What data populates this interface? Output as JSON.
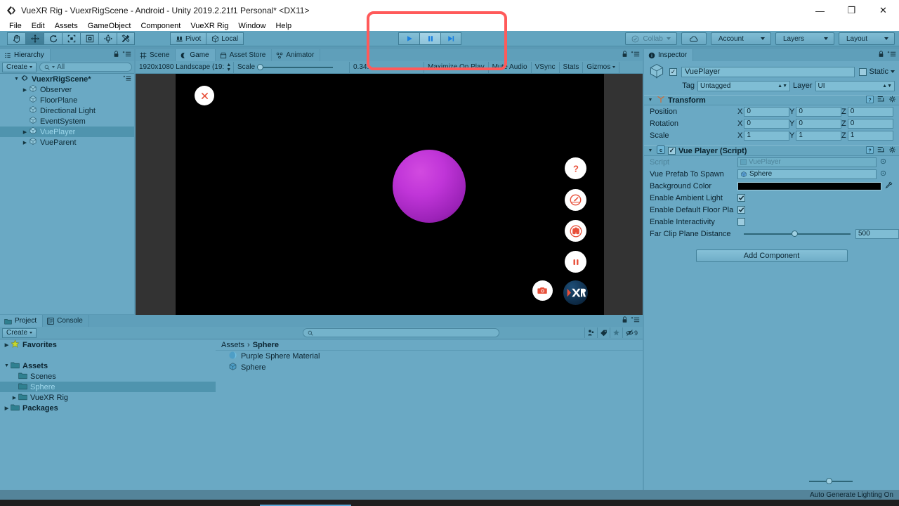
{
  "window": {
    "title": "VueXR Rig - VuexrRigScene - Android - Unity 2019.2.21f1 Personal* <DX11>",
    "app_icon": "unity-logo-icon",
    "minimize": "—",
    "restore": "❐",
    "close": "✕"
  },
  "menubar": {
    "items": [
      "File",
      "Edit",
      "Assets",
      "GameObject",
      "Component",
      "VueXR Rig",
      "Window",
      "Help"
    ]
  },
  "toolbar": {
    "tools": [
      {
        "name": "hand-tool",
        "icon": "hand-icon",
        "active": false
      },
      {
        "name": "move-tool",
        "icon": "move-arrows-icon",
        "active": true
      },
      {
        "name": "rotate-tool",
        "icon": "rotate-icon",
        "active": false
      },
      {
        "name": "scale-tool",
        "icon": "scale-icon",
        "active": false
      },
      {
        "name": "rect-tool",
        "icon": "rect-transform-icon",
        "active": false
      },
      {
        "name": "transform-tool",
        "icon": "combined-transform-icon",
        "active": false
      },
      {
        "name": "custom-editor-tool",
        "icon": "tools-icon",
        "active": false
      }
    ],
    "pivot_label": "Pivot",
    "local_label": "Local",
    "play_label": "play-icon",
    "pause_label": "pause-icon",
    "step_label": "step-icon",
    "collab_label": "Collab",
    "cloud_label": "cloud-icon",
    "account_label": "Account",
    "layers_label": "Layers",
    "layout_label": "Layout"
  },
  "annotation": {
    "color": "#ff5a5a",
    "target": "play-pause-step-controls"
  },
  "hierarchy": {
    "tab_label": "Hierarchy",
    "create_label": "Create",
    "search_placeholder": "All",
    "items": [
      {
        "label": "VuexrRigScene*",
        "depth": 0,
        "expandable": true,
        "expanded": true,
        "selected": false,
        "scene": true
      },
      {
        "label": "Observer",
        "depth": 1,
        "expandable": true,
        "expanded": false,
        "selected": false
      },
      {
        "label": "FloorPlane",
        "depth": 1,
        "expandable": false,
        "expanded": false,
        "selected": false
      },
      {
        "label": "Directional Light",
        "depth": 1,
        "expandable": false,
        "expanded": false,
        "selected": false
      },
      {
        "label": "EventSystem",
        "depth": 1,
        "expandable": false,
        "expanded": false,
        "selected": false
      },
      {
        "label": "VuePlayer",
        "depth": 1,
        "expandable": true,
        "expanded": false,
        "selected": true
      },
      {
        "label": "VueParent",
        "depth": 1,
        "expandable": true,
        "expanded": false,
        "selected": false
      }
    ]
  },
  "center_tabs": [
    {
      "label": "Scene",
      "icon": "grid-icon",
      "active": false
    },
    {
      "label": "Game",
      "icon": "gamepad-icon",
      "active": true
    },
    {
      "label": "Asset Store",
      "icon": "store-icon",
      "active": false
    },
    {
      "label": "Animator",
      "icon": "animator-icon",
      "active": false
    }
  ],
  "gameview": {
    "aspect": "1920x1080 Landscape (19:",
    "scale_label": "Scale",
    "scale_value": "0.34:",
    "maximize_label": "Maximize On Play",
    "mute_label": "Mute Audio",
    "vsync_label": "VSync",
    "stats_label": "Stats",
    "gizmos_label": "Gizmos",
    "overlay_buttons": [
      {
        "name": "close-button",
        "icon": "x-icon",
        "color": "#e8503a"
      },
      {
        "name": "help-button",
        "icon": "question-mark-icon",
        "color": "#e8503a"
      },
      {
        "name": "gauge-button",
        "icon": "speedometer-icon",
        "color": "#e8503a"
      },
      {
        "name": "vr-mode-button",
        "icon": "binoculars-icon",
        "color": "#e8503a"
      },
      {
        "name": "pause-button",
        "icon": "pause-icon",
        "color": "#e8503a"
      },
      {
        "name": "camera-button",
        "icon": "camera-icon",
        "color": "#e8503a"
      },
      {
        "name": "xr-logo-button",
        "icon": "xr-logo-icon",
        "color": "#ffffff"
      }
    ],
    "sphere_color": "#c035d8",
    "background_color": "#000000"
  },
  "inspector": {
    "tab_label": "Inspector",
    "object_name": "VuePlayer",
    "enabled": true,
    "static_label": "Static",
    "tag_label": "Tag",
    "tag_value": "Untagged",
    "layer_label": "Layer",
    "layer_value": "UI",
    "transform": {
      "title": "Transform",
      "rows": [
        {
          "label": "Position",
          "x": "0",
          "y": "0",
          "z": "0"
        },
        {
          "label": "Rotation",
          "x": "0",
          "y": "0",
          "z": "0"
        },
        {
          "label": "Scale",
          "x": "1",
          "y": "1",
          "z": "1"
        }
      ],
      "axis_labels": [
        "X",
        "Y",
        "Z"
      ]
    },
    "script_component": {
      "title": "Vue Player (Script)",
      "enabled": true,
      "script_label": "Script",
      "script_value": "VuePlayer",
      "prefab_label": "Vue Prefab To Spawn",
      "prefab_value": "Sphere",
      "bgcolor_label": "Background Color",
      "bgcolor_value": "#000000",
      "ambient_label": "Enable Ambient Light",
      "ambient_checked": true,
      "floor_label": "Enable Default Floor Pla",
      "floor_checked": true,
      "interactivity_label": "Enable Interactivity",
      "interactivity_checked": false,
      "farclip_label": "Far Clip Plane Distance",
      "farclip_value": "500"
    },
    "add_component_label": "Add Component"
  },
  "project": {
    "tabs": [
      {
        "label": "Project",
        "icon": "folder-icon",
        "active": true
      },
      {
        "label": "Console",
        "icon": "console-icon",
        "active": false
      }
    ],
    "create_label": "Create",
    "search_placeholder": "",
    "filter_icons": [
      "search-by-type-icon",
      "search-by-label-icon",
      "favorites-star-icon",
      "hidden-count-icon"
    ],
    "hidden_count": "9",
    "tree": [
      {
        "label": "Favorites",
        "depth": 0,
        "expandable": true,
        "expanded": false,
        "bold": true,
        "icon": "star-icon",
        "selected": false
      },
      {
        "label": "",
        "depth": 0,
        "spacer": true
      },
      {
        "label": "Assets",
        "depth": 0,
        "expandable": true,
        "expanded": true,
        "bold": true,
        "icon": "folder-icon",
        "selected": false
      },
      {
        "label": "Scenes",
        "depth": 1,
        "expandable": false,
        "expanded": false,
        "bold": false,
        "icon": "folder-icon",
        "selected": false
      },
      {
        "label": "Sphere",
        "depth": 1,
        "expandable": false,
        "expanded": false,
        "bold": false,
        "icon": "folder-icon",
        "selected": true
      },
      {
        "label": "VueXR Rig",
        "depth": 1,
        "expandable": true,
        "expanded": false,
        "bold": false,
        "icon": "folder-icon",
        "selected": false
      },
      {
        "label": "Packages",
        "depth": 0,
        "expandable": true,
        "expanded": false,
        "bold": true,
        "icon": "folder-icon",
        "selected": false
      }
    ],
    "breadcrumb": [
      "Assets",
      "Sphere"
    ],
    "breadcrumb_sep": "›",
    "assets": [
      {
        "label": "Purple Sphere Material",
        "icon": "material-sphere-icon"
      },
      {
        "label": "Sphere",
        "icon": "prefab-cube-icon"
      }
    ]
  },
  "statusbar": {
    "message": "Auto Generate Lighting On"
  }
}
